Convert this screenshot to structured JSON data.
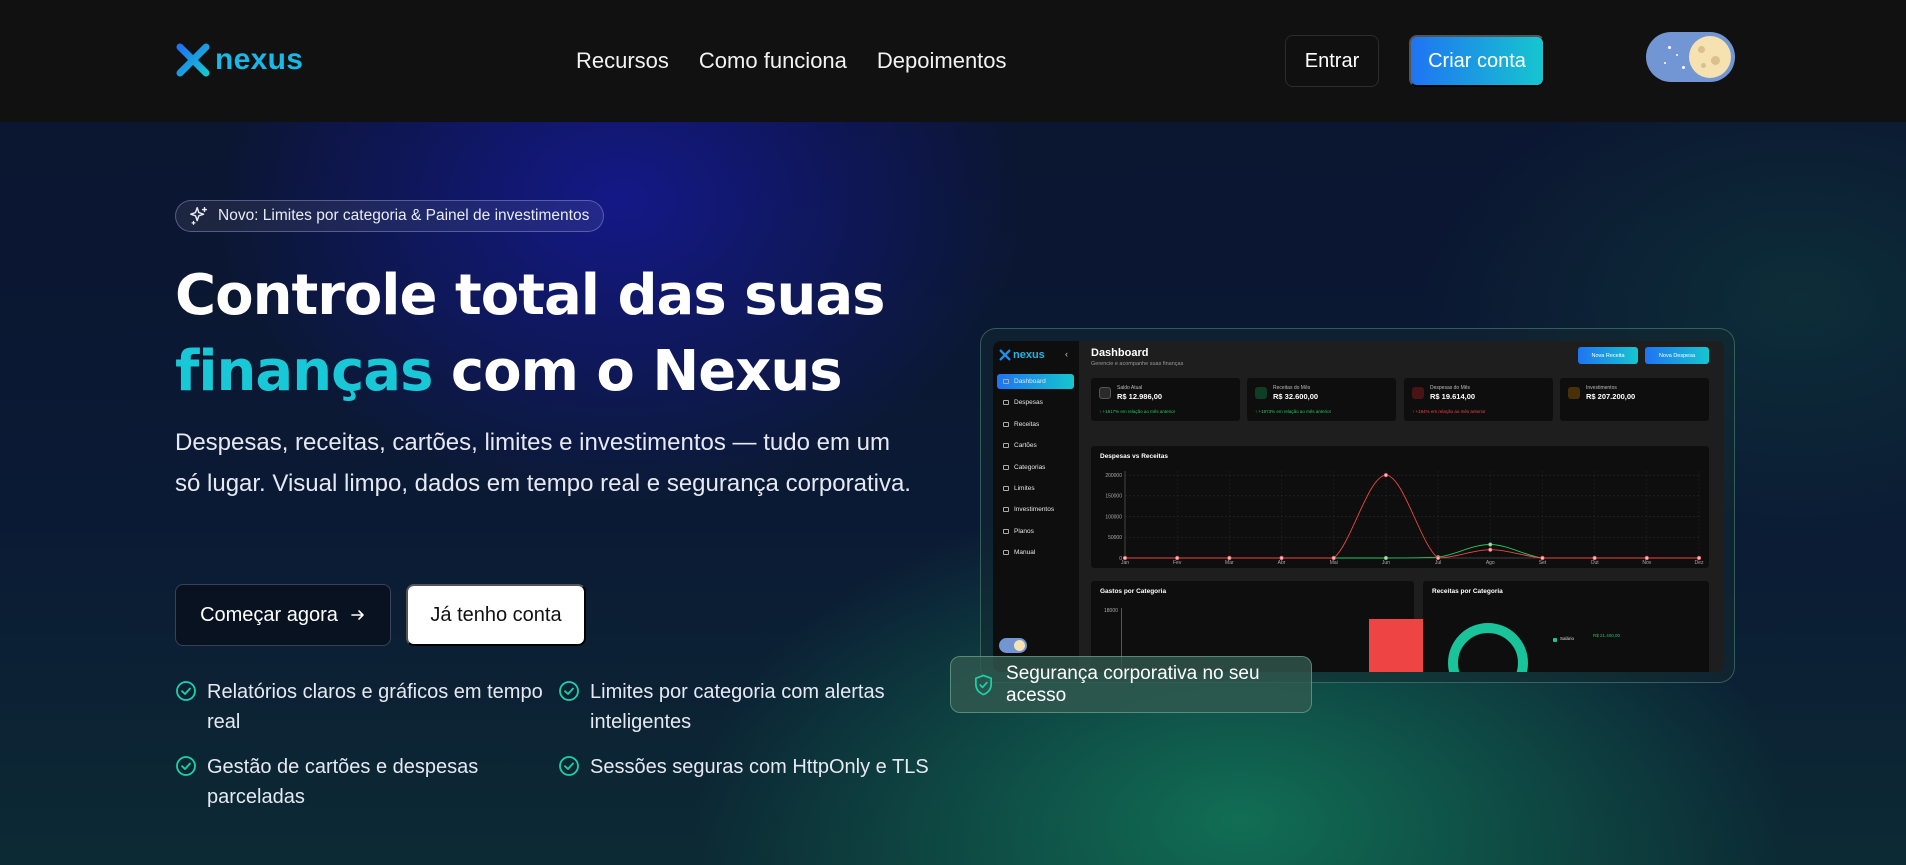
{
  "brand": {
    "name": "nexus"
  },
  "nav": {
    "links": [
      "Recursos",
      "Como funciona",
      "Depoimentos"
    ],
    "login_label": "Entrar",
    "signup_label": "Criar conta"
  },
  "hero": {
    "badge": "Novo: Limites por categoria & Painel de investimentos",
    "title_line1": "Controle total das suas",
    "title_accent": "finanças",
    "title_line2_rest": " com o Nexus",
    "lead": "Despesas, receitas, cartões, limites e investimentos — tudo em um só lugar. Visual limpo, dados em tempo real e segurança corporativa.",
    "cta_primary": "Começar agora",
    "cta_secondary": "Já tenho conta",
    "features": [
      "Relatórios claros e gráficos em tempo real",
      "Limites por categoria com alertas inteligentes",
      "Gestão de cartões e despesas parceladas",
      "Sessões seguras com HttpOnly e TLS"
    ]
  },
  "preview": {
    "sidebar": {
      "logo": "nexus",
      "items": [
        "Dashboard",
        "Despesas",
        "Receitas",
        "Cartões",
        "Categorias",
        "Limites",
        "Investimentos",
        "Planos",
        "Manual"
      ]
    },
    "title": "Dashboard",
    "subtitle": "Gerencie e acompanhe suas finanças",
    "buttons": [
      "Nova Receita",
      "Nova Despesa"
    ],
    "cards": [
      {
        "label": "Saldo Atual",
        "value": "R$ 12.986,00",
        "delta": "↑ +1617% em relação ao mês anterior",
        "color": "#22c55e"
      },
      {
        "label": "Receitas do Mês",
        "value": "R$ 32.600,00",
        "delta": "↑ +1973% em relação ao mês anterior",
        "color": "#22c55e"
      },
      {
        "label": "Despesas do Mês",
        "value": "R$ 19.614,00",
        "delta": "↑ +194% em relação ao mês anterior",
        "color": "#ef4444"
      },
      {
        "label": "Investimentos",
        "value": "R$ 207.200,00",
        "delta": "",
        "color": "#f59e0b"
      }
    ],
    "chart_title": "Despesas vs Receitas",
    "bottom_left_title": "Gastos por Categoria",
    "bottom_left_tick": "18000",
    "bottom_right_title": "Receitas por Categoria",
    "bottom_right_legend": "Salário",
    "bottom_right_value": "R$ 21.400,00"
  },
  "chart_data": {
    "type": "line",
    "title": "Despesas vs Receitas",
    "categories": [
      "Jan",
      "Fev",
      "Mar",
      "Abr",
      "Mai",
      "Jun",
      "Jul",
      "Ago",
      "Set",
      "Out",
      "Nov",
      "Dez"
    ],
    "yticks": [
      0,
      50000,
      100000,
      150000,
      200000
    ],
    "ylim": [
      0,
      210000
    ],
    "series": [
      {
        "name": "Despesas",
        "color": "#ef4444",
        "values": [
          0,
          0,
          0,
          0,
          0,
          200000,
          0,
          20000,
          0,
          0,
          0,
          0
        ]
      },
      {
        "name": "Receitas",
        "color": "#22c55e",
        "values": [
          0,
          0,
          0,
          0,
          0,
          0,
          2000,
          32600,
          0,
          0,
          0,
          0
        ]
      }
    ]
  },
  "security_toast": "Segurança corporativa no seu acesso"
}
